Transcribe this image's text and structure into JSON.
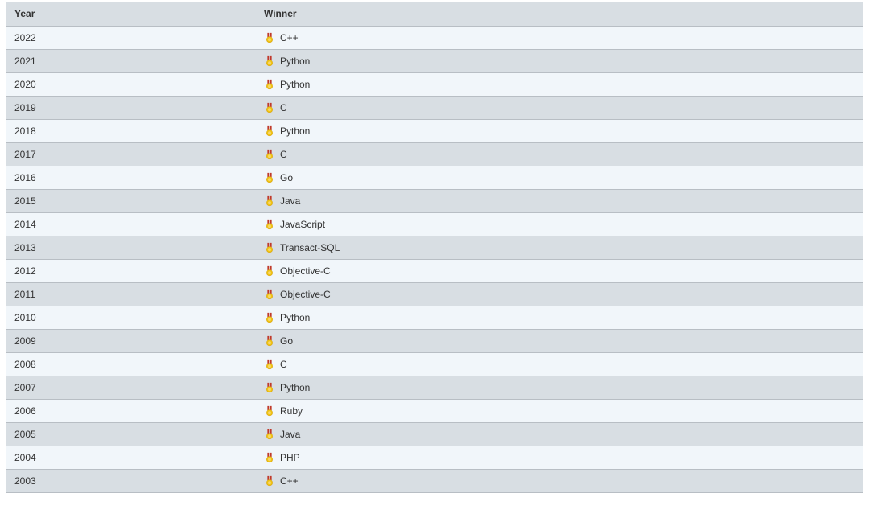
{
  "table": {
    "headers": {
      "year": "Year",
      "winner": "Winner"
    },
    "rows": [
      {
        "year": "2022",
        "winner": "C++"
      },
      {
        "year": "2021",
        "winner": "Python"
      },
      {
        "year": "2020",
        "winner": "Python"
      },
      {
        "year": "2019",
        "winner": "C"
      },
      {
        "year": "2018",
        "winner": "Python"
      },
      {
        "year": "2017",
        "winner": "C"
      },
      {
        "year": "2016",
        "winner": "Go"
      },
      {
        "year": "2015",
        "winner": "Java"
      },
      {
        "year": "2014",
        "winner": "JavaScript"
      },
      {
        "year": "2013",
        "winner": "Transact-SQL"
      },
      {
        "year": "2012",
        "winner": "Objective-C"
      },
      {
        "year": "2011",
        "winner": "Objective-C"
      },
      {
        "year": "2010",
        "winner": "Python"
      },
      {
        "year": "2009",
        "winner": "Go"
      },
      {
        "year": "2008",
        "winner": "C"
      },
      {
        "year": "2007",
        "winner": "Python"
      },
      {
        "year": "2006",
        "winner": "Ruby"
      },
      {
        "year": "2005",
        "winner": "Java"
      },
      {
        "year": "2004",
        "winner": "PHP"
      },
      {
        "year": "2003",
        "winner": "C++"
      }
    ]
  }
}
